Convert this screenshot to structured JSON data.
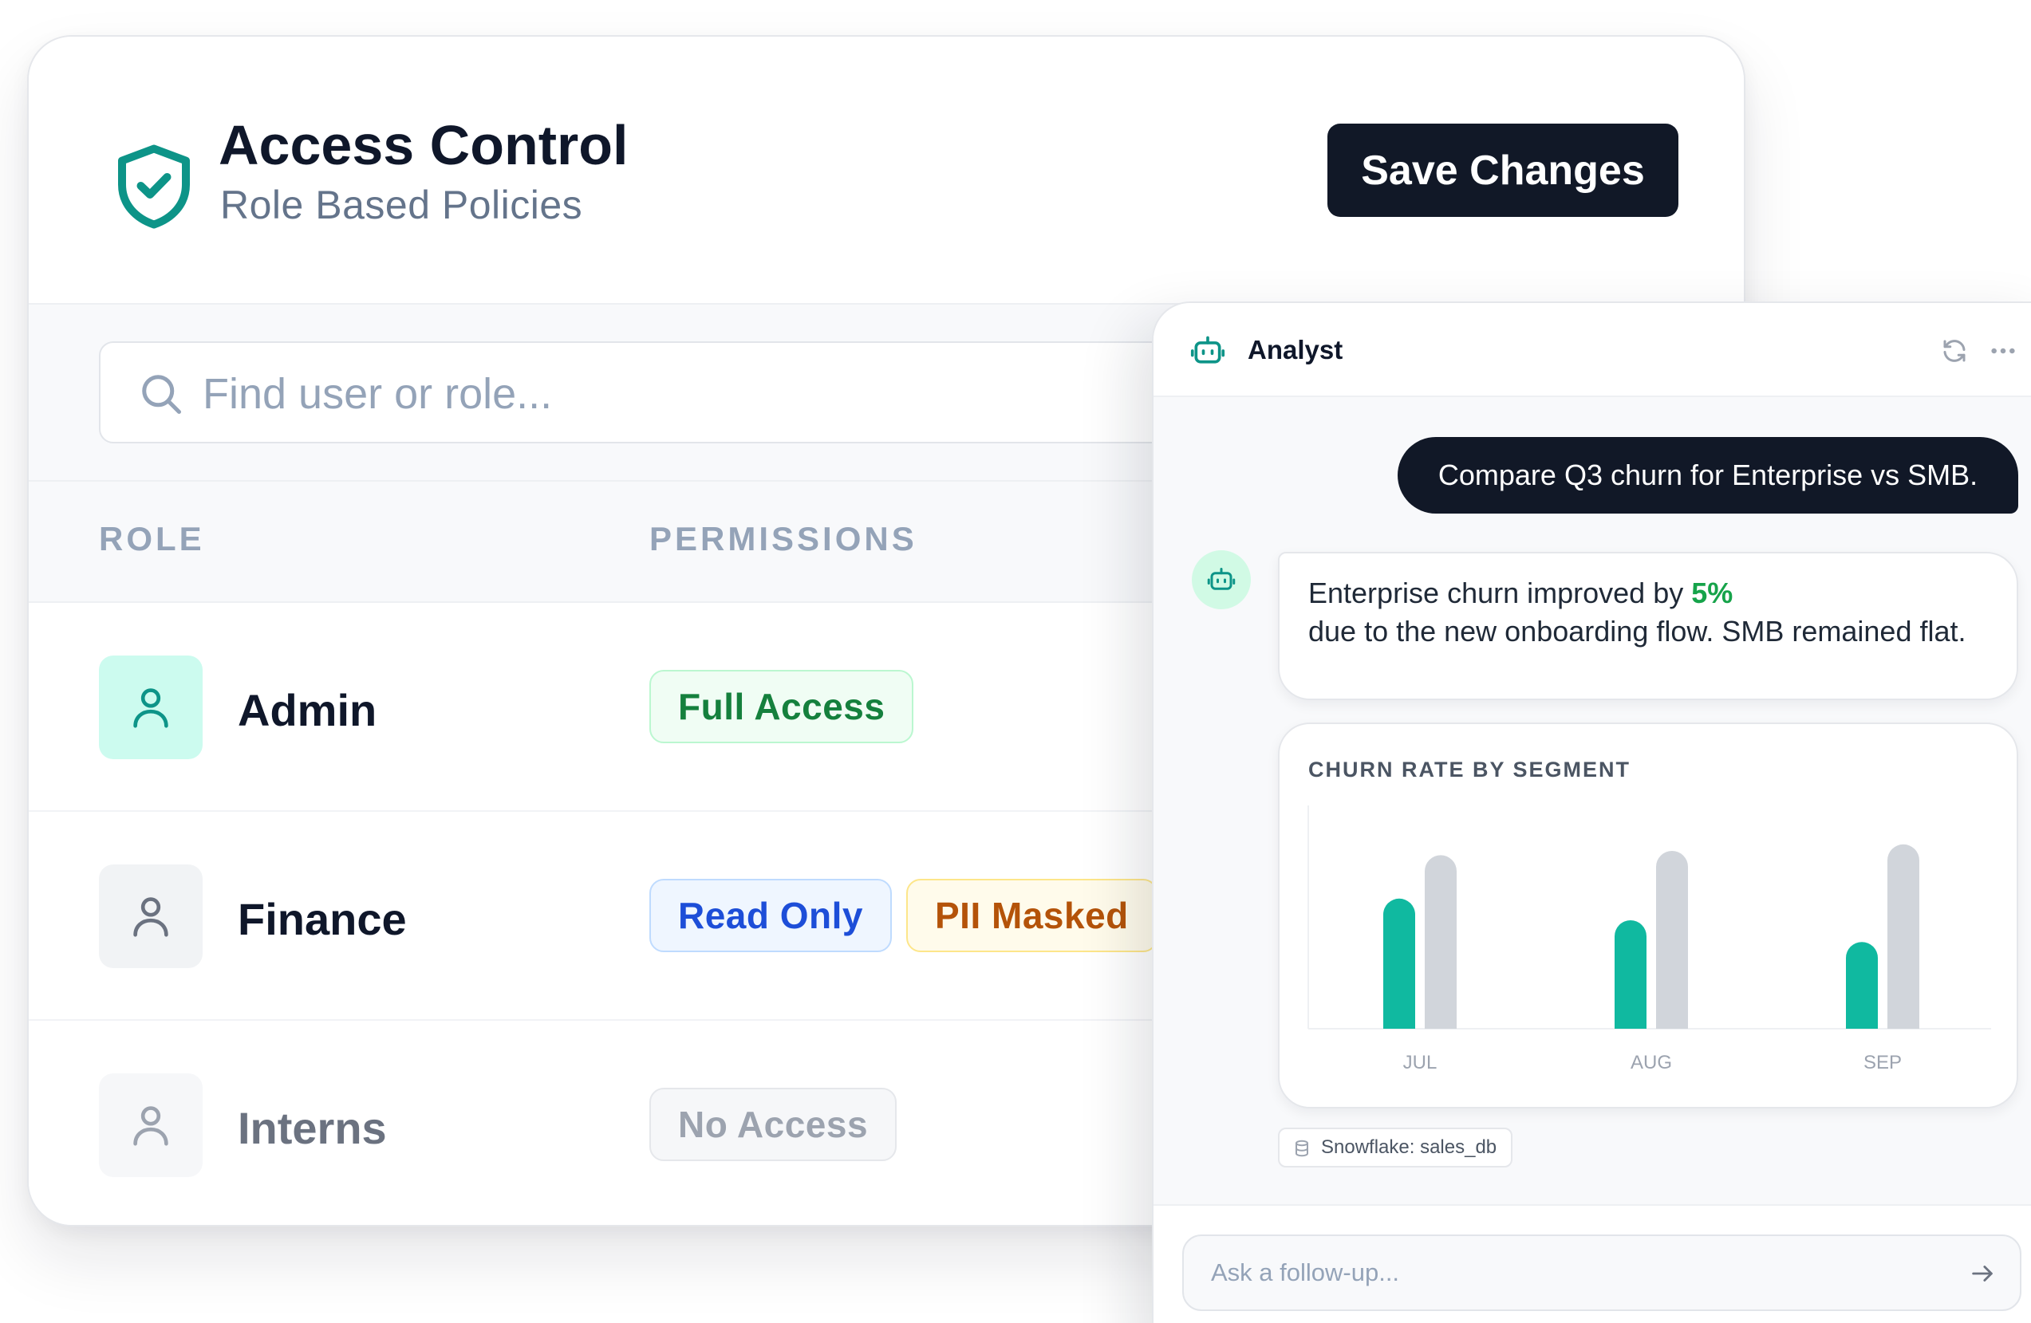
{
  "access_control": {
    "title": "Access Control",
    "subtitle": "Role Based Policies",
    "save_label": "Save Changes",
    "search_placeholder": "Find user or role...",
    "columns": {
      "role": "ROLE",
      "permissions": "PERMISSIONS"
    },
    "roles": [
      {
        "name": "Admin",
        "permissions": [
          {
            "label": "Full Access"
          }
        ]
      },
      {
        "name": "Finance",
        "permissions": [
          {
            "label": "Read Only"
          },
          {
            "label": "PII Masked"
          }
        ]
      },
      {
        "name": "Interns",
        "permissions": [
          {
            "label": "No Access"
          }
        ]
      }
    ]
  },
  "analyst": {
    "title": "Analyst",
    "user_message": "Compare Q3 churn for Enterprise vs SMB.",
    "reply": {
      "before": "Enterprise churn improved by ",
      "highlight": "5%",
      "after": "due to the new onboarding flow. SMB remained flat."
    },
    "source": "Snowflake: sales_db",
    "followup_placeholder": "Ask a follow-up..."
  },
  "chart_data": {
    "type": "bar",
    "title": "CHURN RATE BY SEGMENT",
    "categories": [
      "JUL",
      "AUG",
      "SEP"
    ],
    "series": [
      {
        "values": [
          0.6,
          0.5,
          0.4
        ],
        "color": "#10b9a0"
      },
      {
        "values": [
          0.8,
          0.82,
          0.85
        ],
        "color": "#d1d5db"
      }
    ],
    "ylim": [
      0,
      1
    ],
    "grid": false
  },
  "colors": {
    "brand_teal": "#0d9488",
    "dark": "#111827",
    "success": "#16a34a"
  }
}
